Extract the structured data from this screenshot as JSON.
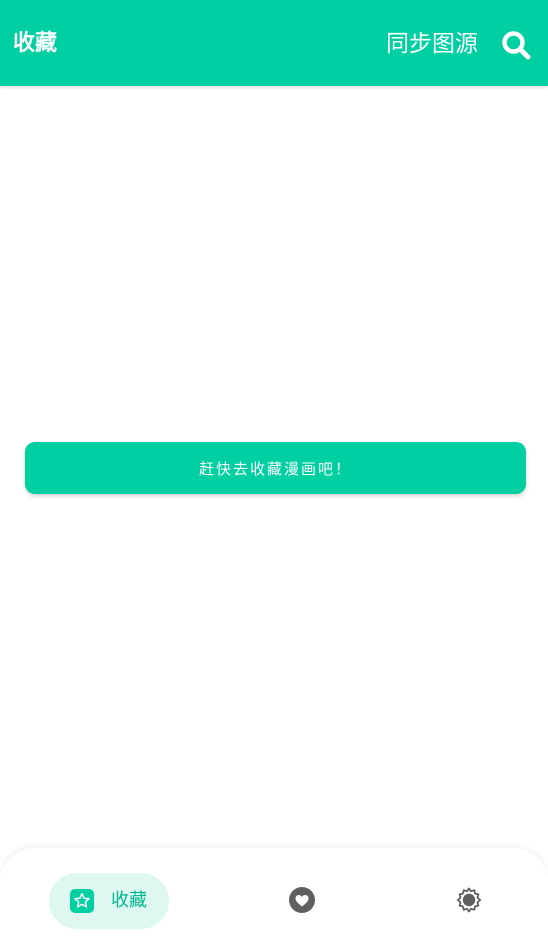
{
  "topbar": {
    "title": "收藏",
    "sync_label": "同步图源",
    "search_icon": "search-icon"
  },
  "main": {
    "cta_label": "赶快去收藏漫画吧！"
  },
  "bottom_nav": {
    "items": [
      {
        "label": "收藏",
        "icon": "star-icon",
        "active": true
      },
      {
        "label": "",
        "icon": "heart-icon",
        "active": false
      },
      {
        "label": "",
        "icon": "gear-icon",
        "active": false
      }
    ]
  },
  "colors": {
    "accent": "#00cfa2",
    "active_pill": "#def8f1",
    "active_text": "#00b68e",
    "inactive_icon": "#5f5f5f"
  }
}
